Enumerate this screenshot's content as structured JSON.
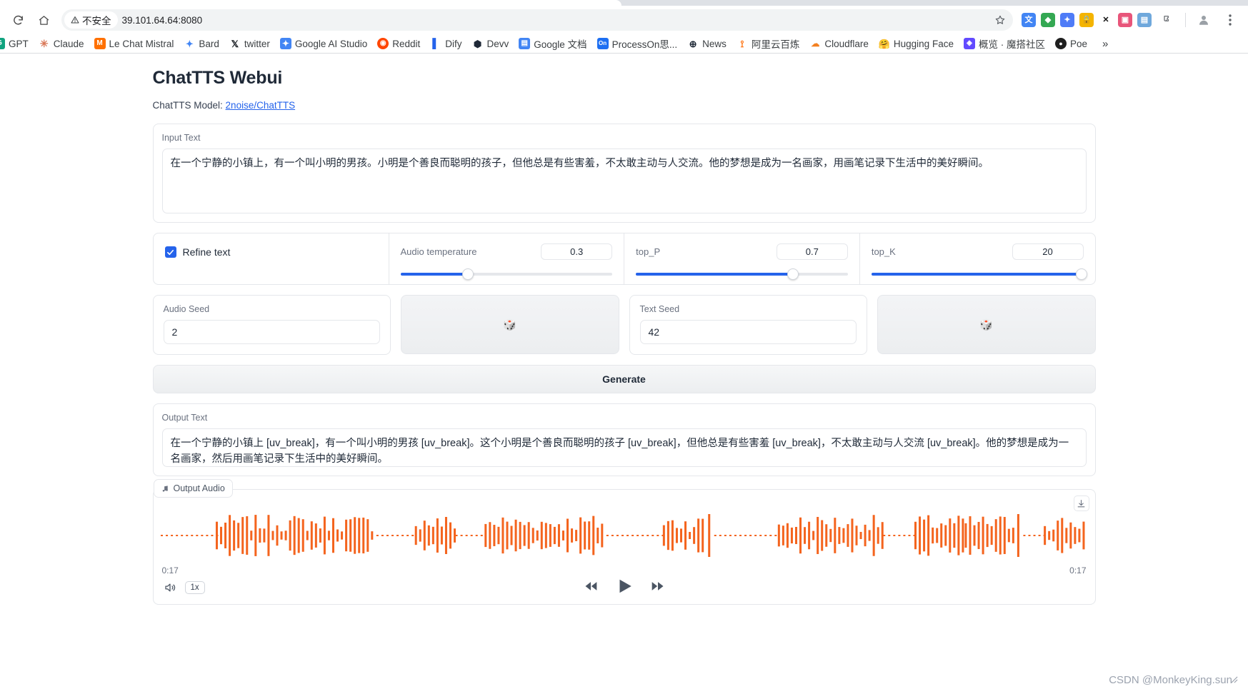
{
  "browser": {
    "reload_icon": "reload-icon",
    "home_icon": "home-icon",
    "security_label": "不安全",
    "url": "39.101.64.64:8080",
    "star_icon": "bookmark-star-icon",
    "extensions": [
      {
        "name": "translate-extension-icon",
        "glyph": "文",
        "bg": "#4285f4"
      },
      {
        "name": "green-extension-icon",
        "glyph": "◆",
        "bg": "#34a853"
      },
      {
        "name": "shield-extension-icon",
        "glyph": "⚙",
        "bg": "#4f7cf7"
      },
      {
        "name": "lock-extension-icon",
        "glyph": "●",
        "bg": "#f4b400"
      },
      {
        "name": "x-extension-icon",
        "glyph": "X",
        "bg": "#1a1a1a"
      },
      {
        "name": "image-extension-icon",
        "glyph": "▣",
        "bg": "#e8557a"
      },
      {
        "name": "notes-extension-icon",
        "glyph": "▤",
        "bg": "#6fa8dc"
      },
      {
        "name": "puzzle-extension-icon",
        "glyph": "❖",
        "bg": "#5f6368"
      },
      {
        "name": "profile-avatar-icon",
        "glyph": "●",
        "bg": "#9aa0a6"
      }
    ],
    "bookmarks": [
      {
        "label": "GPT",
        "glyph": "G",
        "bg": "#10a37f",
        "clipped": true
      },
      {
        "label": "Claude",
        "glyph": "✻",
        "bg": "#ffffff",
        "fg": "#d97757"
      },
      {
        "label": "Le Chat Mistral",
        "glyph": "M",
        "bg": "#ff7000"
      },
      {
        "label": "Bard",
        "glyph": "✦",
        "bg": "#ffffff",
        "fg": "#4285f4"
      },
      {
        "label": "twitter",
        "glyph": "𝕏",
        "bg": "#ffffff",
        "fg": "#0f1419"
      },
      {
        "label": "Google AI Studio",
        "glyph": "✦",
        "bg": "#4285f4"
      },
      {
        "label": "Reddit",
        "glyph": "◉",
        "bg": "#ff4500"
      },
      {
        "label": "Dify",
        "glyph": "█",
        "bg": "#ffffff",
        "fg": "#2563eb"
      },
      {
        "label": "Devv",
        "glyph": "⬟",
        "bg": "#ffffff",
        "fg": "#1f2937"
      },
      {
        "label": "Google 文档",
        "glyph": "☰",
        "bg": "#4285f4"
      },
      {
        "label": "ProcessOn思...",
        "glyph": "On",
        "bg": "#1d6ff2"
      },
      {
        "label": "News",
        "glyph": "⊕",
        "bg": "#ffffff",
        "fg": "#1f2937"
      },
      {
        "label": "阿里云百炼",
        "glyph": "⇄",
        "bg": "#ffffff",
        "fg": "#ff6a00"
      },
      {
        "label": "Cloudflare",
        "glyph": "☁",
        "bg": "#ffffff",
        "fg": "#f38020"
      },
      {
        "label": "Hugging Face",
        "glyph": "😀",
        "bg": "#ffffff",
        "fg": "#ffcc4d"
      },
      {
        "label": "概览 · 魔搭社区",
        "glyph": "◈",
        "bg": "#624aff"
      },
      {
        "label": "Poe",
        "glyph": "●",
        "bg": "#1f1f1f"
      }
    ],
    "overflow_label": "»"
  },
  "app": {
    "title": "ChatTTS Webui",
    "model_prefix": "ChatTTS Model: ",
    "model_link": "2noise/ChatTTS",
    "input": {
      "label": "Input Text",
      "value": "在一个宁静的小镇上，有一个叫小明的男孩。小明是个善良而聪明的孩子，但他总是有些害羞，不太敢主动与人交流。他的梦想是成为一名画家，用画笔记录下生活中的美好瞬间。"
    },
    "params": {
      "refine_label": "Refine text",
      "refine_checked": true,
      "sliders": [
        {
          "name": "Audio temperature",
          "value": "0.3",
          "percent": 32
        },
        {
          "name": "top_P",
          "value": "0.7",
          "percent": 74
        },
        {
          "name": "top_K",
          "value": "20",
          "percent": 99
        }
      ]
    },
    "seeds": [
      {
        "label": "Audio Seed",
        "value": "2"
      },
      {
        "label": "Text Seed",
        "value": "42"
      }
    ],
    "dice_icon": "🎲",
    "generate_label": "Generate",
    "output": {
      "label": "Output Text",
      "value": "在一个宁静的小镇上 [uv_break]，有一个叫小明的男孩 [uv_break]。这个小明是个善良而聪明的孩子 [uv_break]，但他总是有些害羞 [uv_break]，不太敢主动与人交流 [uv_break]。他的梦想是成为一名画家，然后用画笔记录下生活中的美好瞬间。"
    },
    "audio": {
      "tab_label": "Output Audio",
      "music_icon": "music-note-icon",
      "download_icon": "download-icon",
      "time_start": "0:17",
      "time_end": "0:17",
      "speed_label": "1x",
      "speaker_icon": "volume-icon",
      "rewind_icon": "rewind-icon",
      "play_icon": "play-icon",
      "forward_icon": "fast-forward-icon",
      "waveform_color": "#f4641e"
    }
  },
  "watermark": "CSDN @MonkeyKing.sun"
}
